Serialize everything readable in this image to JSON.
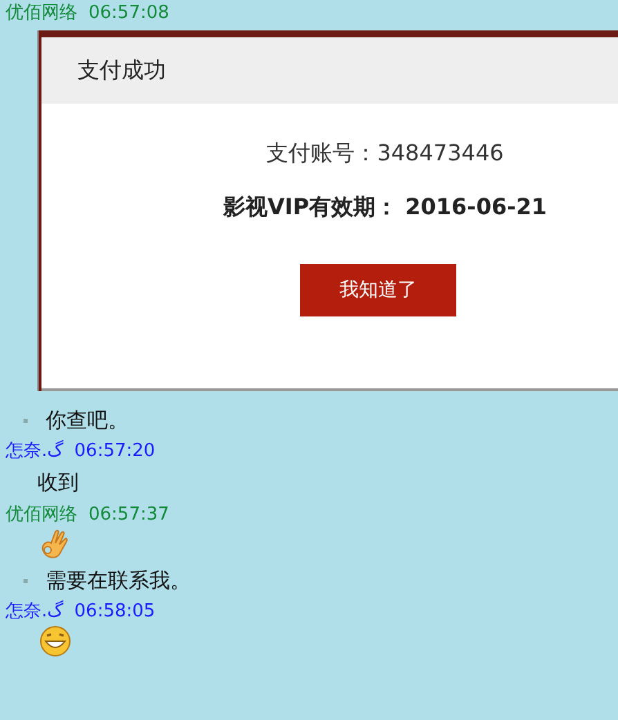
{
  "messages": [
    {
      "kind": "header",
      "sender": "优佰网络",
      "time": "06:57:08",
      "color": "#138a3a"
    },
    {
      "kind": "screenshot",
      "dialog": {
        "title": "支付成功",
        "account_label": "支付账号：",
        "account": "348473446",
        "expiry_label": "影视VIP有效期：",
        "expiry": "2016-06-21",
        "button": "我知道了"
      }
    },
    {
      "kind": "bullet",
      "text": "你查吧。"
    },
    {
      "kind": "header",
      "sender": "怎奈.گ",
      "time": "06:57:20",
      "color": "#1a1aff"
    },
    {
      "kind": "text",
      "text": "收到"
    },
    {
      "kind": "header",
      "sender": "优佰网络",
      "time": "06:57:37",
      "color": "#138a3a"
    },
    {
      "kind": "okhand"
    },
    {
      "kind": "bullet",
      "text": "需要在联系我。"
    },
    {
      "kind": "header",
      "sender": "怎奈.گ",
      "time": "06:58:05",
      "color": "#1a1aff"
    },
    {
      "kind": "grin"
    }
  ]
}
